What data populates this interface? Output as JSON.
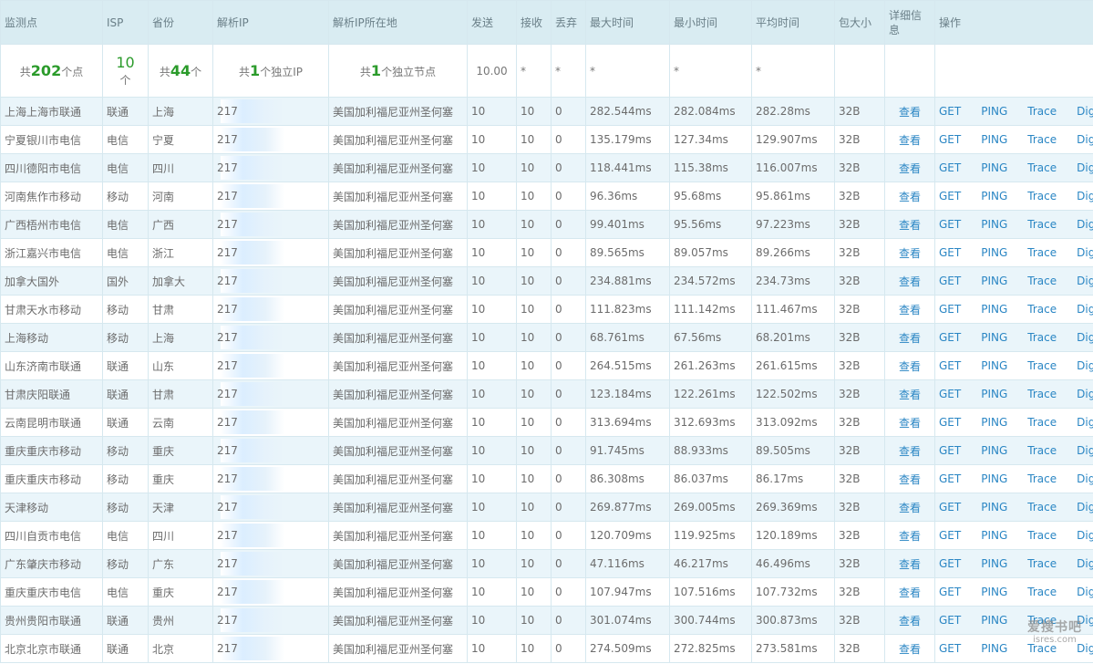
{
  "headers": {
    "node": "监测点",
    "isp": "ISP",
    "province": "省份",
    "ip": "解析IP",
    "ip_location": "解析IP所在地",
    "sent": "发送",
    "received": "接收",
    "lost": "丢弃",
    "max_time": "最大时间",
    "min_time": "最小时间",
    "avg_time": "平均时间",
    "packet_size": "包大小",
    "details": "详细信息",
    "actions": "操作"
  },
  "summary": {
    "nodes_prefix": "共",
    "nodes_count": "202",
    "nodes_suffix": "个点",
    "isp_count": "10",
    "isp_unit": "个",
    "province_prefix": "共",
    "province_count": "44",
    "province_suffix": "个",
    "ip_prefix": "共",
    "ip_count": "1",
    "ip_suffix": "个独立IP",
    "loc_prefix": "共",
    "loc_count": "1",
    "loc_suffix": "个独立节点",
    "sent": "10.00",
    "received": "*",
    "lost": "*",
    "max_time": "*",
    "min_time": "*",
    "avg_time": "*"
  },
  "actions": {
    "view": "查看",
    "get": "GET",
    "ping": "PING",
    "trace": "Trace",
    "dig": "Dig"
  },
  "colors": {
    "avg_red": "#c0392b",
    "avg_orange": "#e0751a",
    "avg_yellow": "#f0a500",
    "link": "#2a86c4",
    "header_bg": "#d9ecf2",
    "row_alt_bg": "#eaf5fa"
  },
  "rows": [
    {
      "node": "上海上海市联通",
      "isp": "联通",
      "province": "上海",
      "ip": "217",
      "location": "美国加利福尼亚州圣何塞",
      "sent": "10",
      "received": "10",
      "lost": "0",
      "max": "282.544ms",
      "min": "282.084ms",
      "avg": "282.28ms",
      "avg_color": "red",
      "size": "32B"
    },
    {
      "node": "宁夏银川市电信",
      "isp": "电信",
      "province": "宁夏",
      "ip": "217",
      "location": "美国加利福尼亚州圣何塞",
      "sent": "10",
      "received": "10",
      "lost": "0",
      "max": "135.179ms",
      "min": "127.34ms",
      "avg": "129.907ms",
      "avg_color": "red",
      "size": "32B"
    },
    {
      "node": "四川德阳市电信",
      "isp": "电信",
      "province": "四川",
      "ip": "217",
      "location": "美国加利福尼亚州圣何塞",
      "sent": "10",
      "received": "10",
      "lost": "0",
      "max": "118.441ms",
      "min": "115.38ms",
      "avg": "116.007ms",
      "avg_color": "red",
      "size": "32B"
    },
    {
      "node": "河南焦作市移动",
      "isp": "移动",
      "province": "河南",
      "ip": "217",
      "location": "美国加利福尼亚州圣何塞",
      "sent": "10",
      "received": "10",
      "lost": "0",
      "max": "96.36ms",
      "min": "95.68ms",
      "avg": "95.861ms",
      "avg_color": "orange",
      "size": "32B"
    },
    {
      "node": "广西梧州市电信",
      "isp": "电信",
      "province": "广西",
      "ip": "217",
      "location": "美国加利福尼亚州圣何塞",
      "sent": "10",
      "received": "10",
      "lost": "0",
      "max": "99.401ms",
      "min": "95.56ms",
      "avg": "97.223ms",
      "avg_color": "orange",
      "size": "32B"
    },
    {
      "node": "浙江嘉兴市电信",
      "isp": "电信",
      "province": "浙江",
      "ip": "217",
      "location": "美国加利福尼亚州圣何塞",
      "sent": "10",
      "received": "10",
      "lost": "0",
      "max": "89.565ms",
      "min": "89.057ms",
      "avg": "89.266ms",
      "avg_color": "orange",
      "size": "32B"
    },
    {
      "node": "加拿大国外",
      "isp": "国外",
      "province": "加拿大",
      "ip": "217",
      "location": "美国加利福尼亚州圣何塞",
      "sent": "10",
      "received": "10",
      "lost": "0",
      "max": "234.881ms",
      "min": "234.572ms",
      "avg": "234.73ms",
      "avg_color": "red",
      "size": "32B"
    },
    {
      "node": "甘肃天水市移动",
      "isp": "移动",
      "province": "甘肃",
      "ip": "217",
      "location": "美国加利福尼亚州圣何塞",
      "sent": "10",
      "received": "10",
      "lost": "0",
      "max": "111.823ms",
      "min": "111.142ms",
      "avg": "111.467ms",
      "avg_color": "red",
      "size": "32B"
    },
    {
      "node": "上海移动",
      "isp": "移动",
      "province": "上海",
      "ip": "217",
      "location": "美国加利福尼亚州圣何塞",
      "sent": "10",
      "received": "10",
      "lost": "0",
      "max": "68.761ms",
      "min": "67.56ms",
      "avg": "68.201ms",
      "avg_color": "orange",
      "size": "32B"
    },
    {
      "node": "山东济南市联通",
      "isp": "联通",
      "province": "山东",
      "ip": "217",
      "location": "美国加利福尼亚州圣何塞",
      "sent": "10",
      "received": "10",
      "lost": "0",
      "max": "264.515ms",
      "min": "261.263ms",
      "avg": "261.615ms",
      "avg_color": "red",
      "size": "32B"
    },
    {
      "node": "甘肃庆阳联通",
      "isp": "联通",
      "province": "甘肃",
      "ip": "217",
      "location": "美国加利福尼亚州圣何塞",
      "sent": "10",
      "received": "10",
      "lost": "0",
      "max": "123.184ms",
      "min": "122.261ms",
      "avg": "122.502ms",
      "avg_color": "red",
      "size": "32B"
    },
    {
      "node": "云南昆明市联通",
      "isp": "联通",
      "province": "云南",
      "ip": "217",
      "location": "美国加利福尼亚州圣何塞",
      "sent": "10",
      "received": "10",
      "lost": "0",
      "max": "313.694ms",
      "min": "312.693ms",
      "avg": "313.092ms",
      "avg_color": "red",
      "size": "32B"
    },
    {
      "node": "重庆重庆市移动",
      "isp": "移动",
      "province": "重庆",
      "ip": "217",
      "location": "美国加利福尼亚州圣何塞",
      "sent": "10",
      "received": "10",
      "lost": "0",
      "max": "91.745ms",
      "min": "88.933ms",
      "avg": "89.505ms",
      "avg_color": "orange",
      "size": "32B"
    },
    {
      "node": "重庆重庆市移动",
      "isp": "移动",
      "province": "重庆",
      "ip": "217",
      "location": "美国加利福尼亚州圣何塞",
      "sent": "10",
      "received": "10",
      "lost": "0",
      "max": "86.308ms",
      "min": "86.037ms",
      "avg": "86.17ms",
      "avg_color": "orange",
      "size": "32B"
    },
    {
      "node": "天津移动",
      "isp": "移动",
      "province": "天津",
      "ip": "217",
      "location": "美国加利福尼亚州圣何塞",
      "sent": "10",
      "received": "10",
      "lost": "0",
      "max": "269.877ms",
      "min": "269.005ms",
      "avg": "269.369ms",
      "avg_color": "red",
      "size": "32B"
    },
    {
      "node": "四川自贡市电信",
      "isp": "电信",
      "province": "四川",
      "ip": "217",
      "location": "美国加利福尼亚州圣何塞",
      "sent": "10",
      "received": "10",
      "lost": "0",
      "max": "120.709ms",
      "min": "119.925ms",
      "avg": "120.189ms",
      "avg_color": "red",
      "size": "32B"
    },
    {
      "node": "广东肇庆市移动",
      "isp": "移动",
      "province": "广东",
      "ip": "217",
      "location": "美国加利福尼亚州圣何塞",
      "sent": "10",
      "received": "10",
      "lost": "0",
      "max": "47.116ms",
      "min": "46.217ms",
      "avg": "46.496ms",
      "avg_color": "yellow",
      "size": "32B"
    },
    {
      "node": "重庆重庆市电信",
      "isp": "电信",
      "province": "重庆",
      "ip": "217",
      "location": "美国加利福尼亚州圣何塞",
      "sent": "10",
      "received": "10",
      "lost": "0",
      "max": "107.947ms",
      "min": "107.516ms",
      "avg": "107.732ms",
      "avg_color": "red",
      "size": "32B"
    },
    {
      "node": "贵州贵阳市联通",
      "isp": "联通",
      "province": "贵州",
      "ip": "217",
      "location": "美国加利福尼亚州圣何塞",
      "sent": "10",
      "received": "10",
      "lost": "0",
      "max": "301.074ms",
      "min": "300.744ms",
      "avg": "300.873ms",
      "avg_color": "red",
      "size": "32B"
    },
    {
      "node": "北京北京市联通",
      "isp": "联通",
      "province": "北京",
      "ip": "217",
      "location": "美国加利福尼亚州圣何塞",
      "sent": "10",
      "received": "10",
      "lost": "0",
      "max": "274.509ms",
      "min": "272.825ms",
      "avg": "273.581ms",
      "avg_color": "red",
      "size": "32B"
    }
  ],
  "watermark": {
    "top": "爱搜书吧",
    "bottom": "isres.com"
  }
}
